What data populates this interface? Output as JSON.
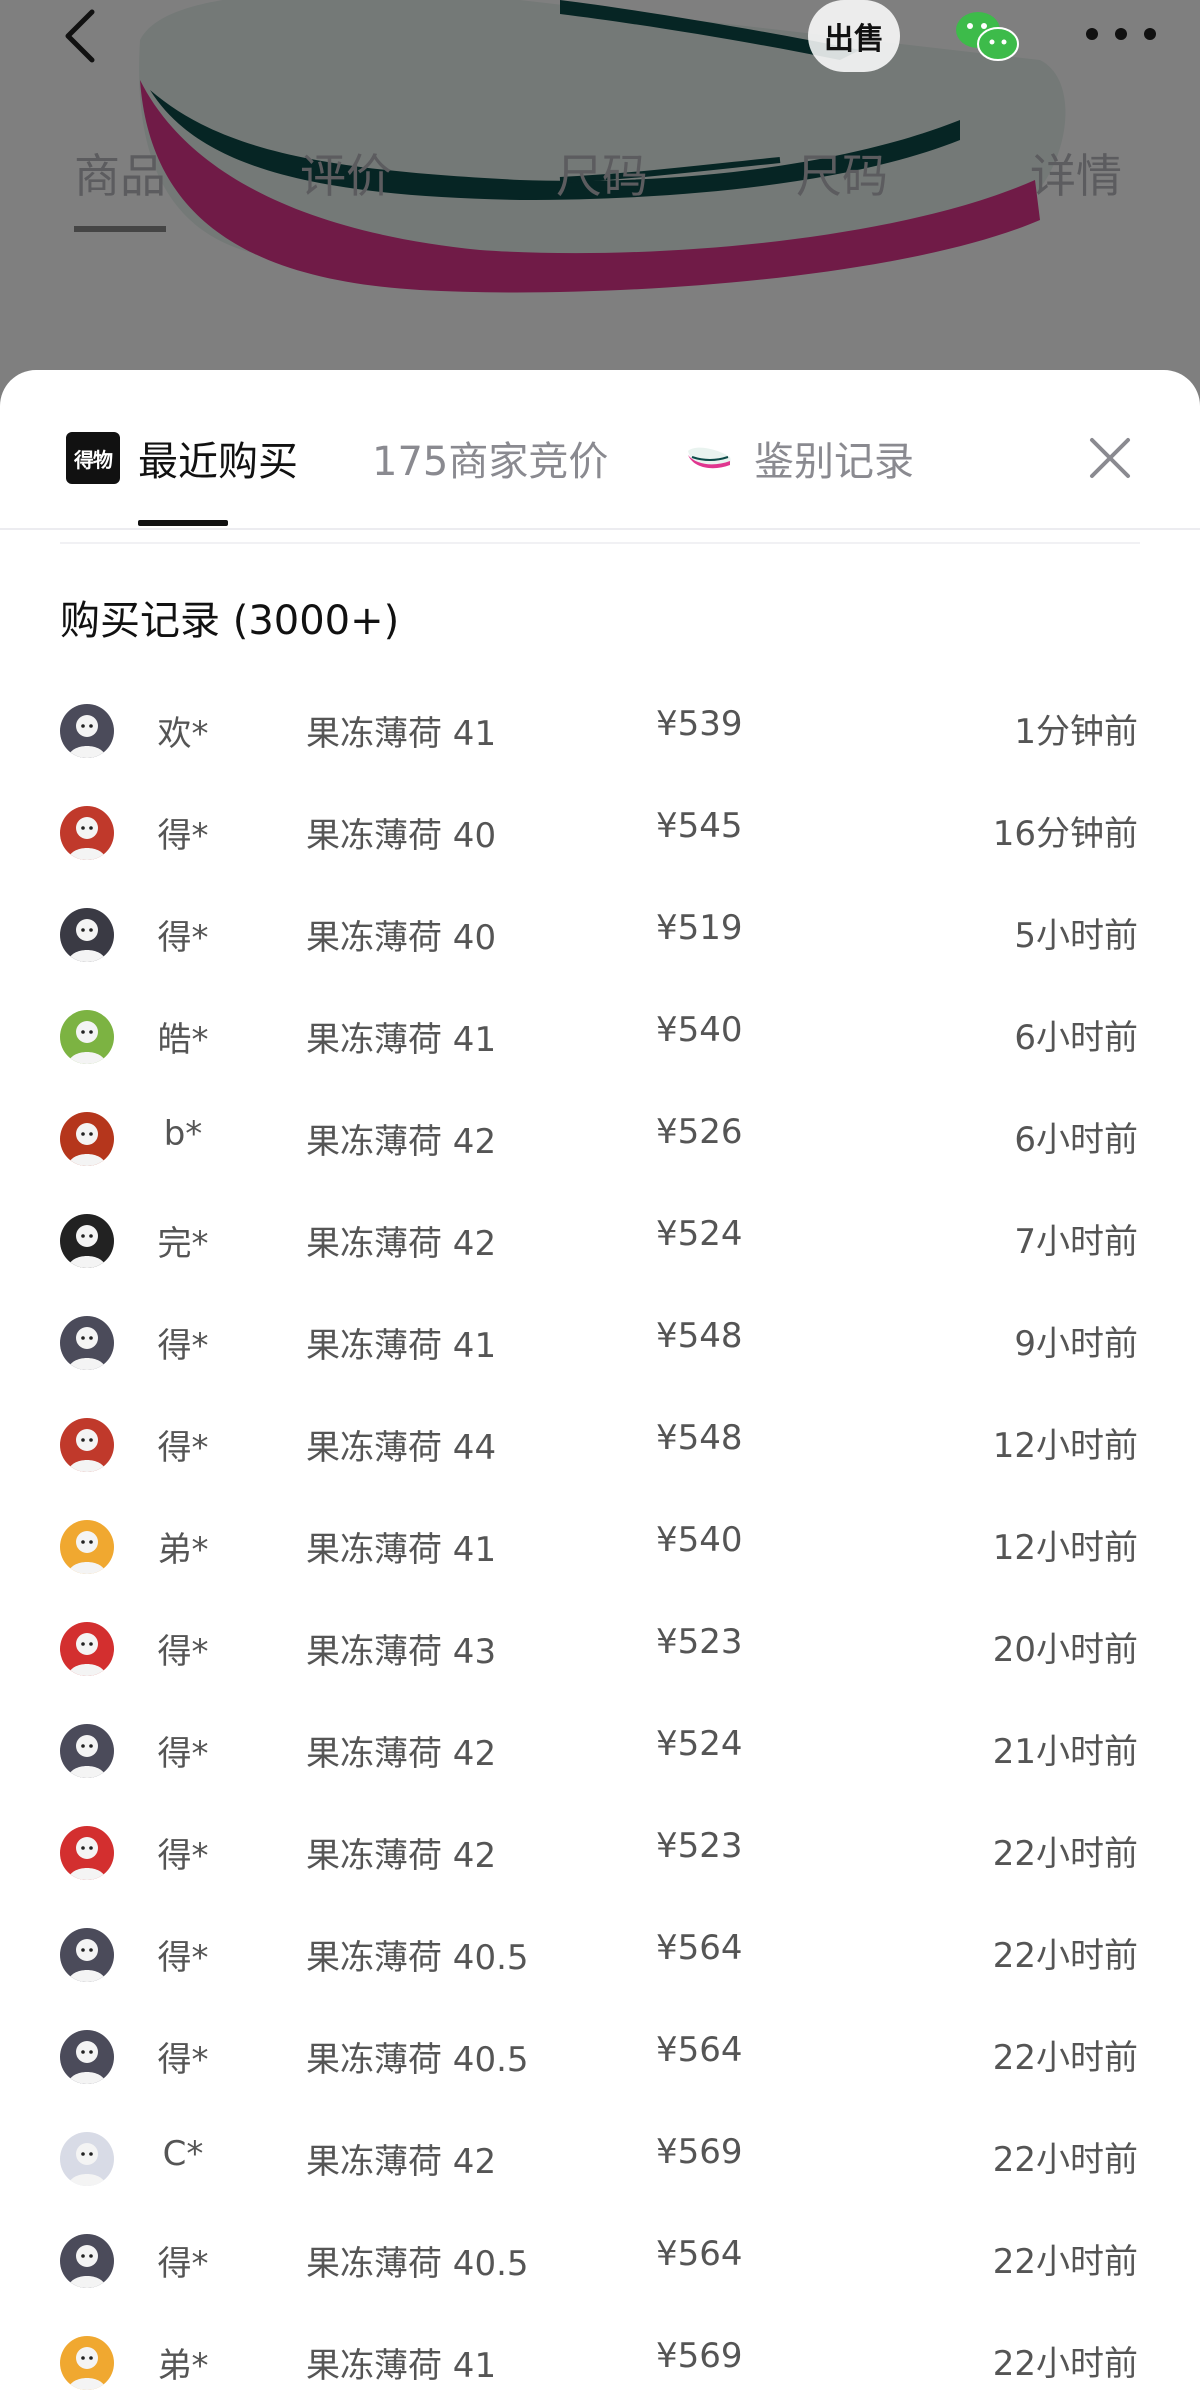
{
  "background_page": {
    "tabs": [
      "商品",
      "评价",
      "尺码",
      "尺码",
      "详情"
    ],
    "sell_label": "出售"
  },
  "sheet": {
    "tabs": [
      {
        "label": "最近购买",
        "active": true
      },
      {
        "label": "175商家竞价",
        "active": false
      },
      {
        "label": "鉴别记录",
        "active": false
      }
    ],
    "logo_text": "得物",
    "section_title": "购买记录 (3000+)",
    "records": [
      {
        "user": "欢*",
        "spec": "果冻薄荷 41",
        "price": "¥539",
        "time": "1分钟前",
        "avatar": "#4b4b5a"
      },
      {
        "user": "得*",
        "spec": "果冻薄荷 40",
        "price": "¥545",
        "time": "16分钟前",
        "avatar": "#c0392b"
      },
      {
        "user": "得*",
        "spec": "果冻薄荷 40",
        "price": "¥519",
        "time": "5小时前",
        "avatar": "#3a3a44"
      },
      {
        "user": "皓*",
        "spec": "果冻薄荷 41",
        "price": "¥540",
        "time": "6小时前",
        "avatar": "#7cb342"
      },
      {
        "user": "b*",
        "spec": "果冻薄荷 42",
        "price": "¥526",
        "time": "6小时前",
        "avatar": "#b5361c"
      },
      {
        "user": "完*",
        "spec": "果冻薄荷 42",
        "price": "¥524",
        "time": "7小时前",
        "avatar": "#222222"
      },
      {
        "user": "得*",
        "spec": "果冻薄荷 41",
        "price": "¥548",
        "time": "9小时前",
        "avatar": "#4b4b5a"
      },
      {
        "user": "得*",
        "spec": "果冻薄荷 44",
        "price": "¥548",
        "time": "12小时前",
        "avatar": "#c0392b"
      },
      {
        "user": "弟*",
        "spec": "果冻薄荷 41",
        "price": "¥540",
        "time": "12小时前",
        "avatar": "#f0a830"
      },
      {
        "user": "得*",
        "spec": "果冻薄荷 43",
        "price": "¥523",
        "time": "20小时前",
        "avatar": "#d32f2f"
      },
      {
        "user": "得*",
        "spec": "果冻薄荷 42",
        "price": "¥524",
        "time": "21小时前",
        "avatar": "#4b4b5a"
      },
      {
        "user": "得*",
        "spec": "果冻薄荷 42",
        "price": "¥523",
        "time": "22小时前",
        "avatar": "#d32f2f"
      },
      {
        "user": "得*",
        "spec": "果冻薄荷 40.5",
        "price": "¥564",
        "time": "22小时前",
        "avatar": "#4b4b5a"
      },
      {
        "user": "得*",
        "spec": "果冻薄荷 40.5",
        "price": "¥564",
        "time": "22小时前",
        "avatar": "#4b4b5a"
      },
      {
        "user": "C*",
        "spec": "果冻薄荷 42",
        "price": "¥569",
        "time": "22小时前",
        "avatar": "#d8dbe6"
      },
      {
        "user": "得*",
        "spec": "果冻薄荷 40.5",
        "price": "¥564",
        "time": "22小时前",
        "avatar": "#4b4b5a"
      },
      {
        "user": "弟*",
        "spec": "果冻薄荷 41",
        "price": "¥569",
        "time": "22小时前",
        "avatar": "#f0a830"
      }
    ]
  },
  "colors": {
    "accent": "#111111",
    "muted_text": "#555555",
    "inactive_tab": "#8a8a90"
  }
}
